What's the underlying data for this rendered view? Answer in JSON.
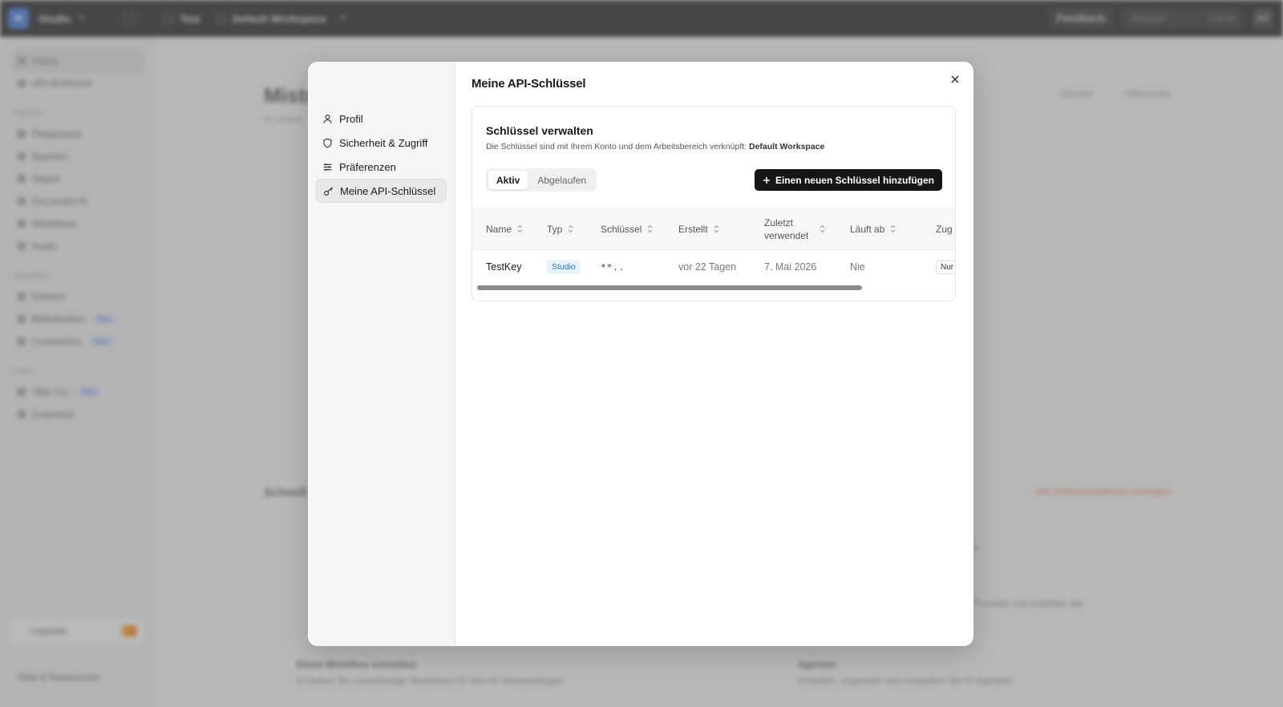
{
  "app": {
    "name": "Studio",
    "tab_project": "Test",
    "workspace": "Default Workspace",
    "feedback": "Feedback",
    "search_placeholder": "Suchen",
    "search_shortcut": "Ctrl K",
    "avatar": "AC"
  },
  "sidebar": {
    "items_top": [
      "Home",
      "API-Schlüssel"
    ],
    "section_create": "Erstellen",
    "items_create": [
      "Playground",
      "Agenten",
      "Stapel",
      "Document AI",
      "Workflows",
      "Audio"
    ],
    "section_manage": "Verwalten",
    "items_manage": [
      "Dateien",
      "Bibliotheken",
      "Connectors"
    ],
    "section_code": "Code",
    "items_code": [
      "Vibe CLI",
      "Codestral"
    ],
    "new_badge": "Neu",
    "upgrade": "Upgrade",
    "help": "Hilfe & Ressourcen"
  },
  "background": {
    "title": "Mistr",
    "subtitle": "Ihr Arbeit",
    "link_discord": "Discord",
    "link_help": "Hilfecenter",
    "section_quick": "Schnell",
    "orange_link": "Alle Dokumentationen anzeigen",
    "card_workflow_title": "Einen Workflow schreiben",
    "card_workflow_desc": "Erstellen Sie zuverlässige Workflows für Ihre KI-Anwendungen",
    "card_agents_title": "Agenten",
    "card_agents_desc": "Erstellen, anpassen und verwalten Sie KI-Agenten",
    "card_right_text_1": "ssen",
    "card_right_text_2": "die Prompts und erstellen Sie"
  },
  "modal": {
    "title": "Meine API-Schlüssel",
    "nav": [
      {
        "label": "Profil",
        "icon": "user-icon"
      },
      {
        "label": "Sicherheit & Zugriff",
        "icon": "shield-icon"
      },
      {
        "label": "Präferenzen",
        "icon": "sliders-icon"
      },
      {
        "label": "Meine API-Schlüssel",
        "icon": "key-icon",
        "active": true
      }
    ],
    "card": {
      "title": "Schlüssel verwalten",
      "desc_prefix": "Die Schlüssel sind mit Ihrem Konto und dem Arbeitsbereich verknüpft:",
      "desc_workspace": "Default Workspace",
      "tabs": [
        "Aktiv",
        "Abgelaufen"
      ],
      "add_button": "Einen neuen Schlüssel hinzufügen",
      "columns": [
        "Name",
        "Typ",
        "Schlüssel",
        "Erstellt",
        "Zuletzt verwendet",
        "Läuft ab",
        "Zug"
      ],
      "rows": [
        {
          "name": "TestKey",
          "type": "Studio",
          "key": "**..",
          "created": "vor 22 Tagen",
          "last_used": "7. Mai 2026",
          "expires": "Nie",
          "access": "Nur"
        }
      ]
    }
  },
  "colors": {
    "topbar": "#1f1f21",
    "accent_blue": "#3b6fd6",
    "button_dark": "#161616",
    "badge_bg": "#eaf3fb",
    "badge_text": "#3a6fa8"
  }
}
